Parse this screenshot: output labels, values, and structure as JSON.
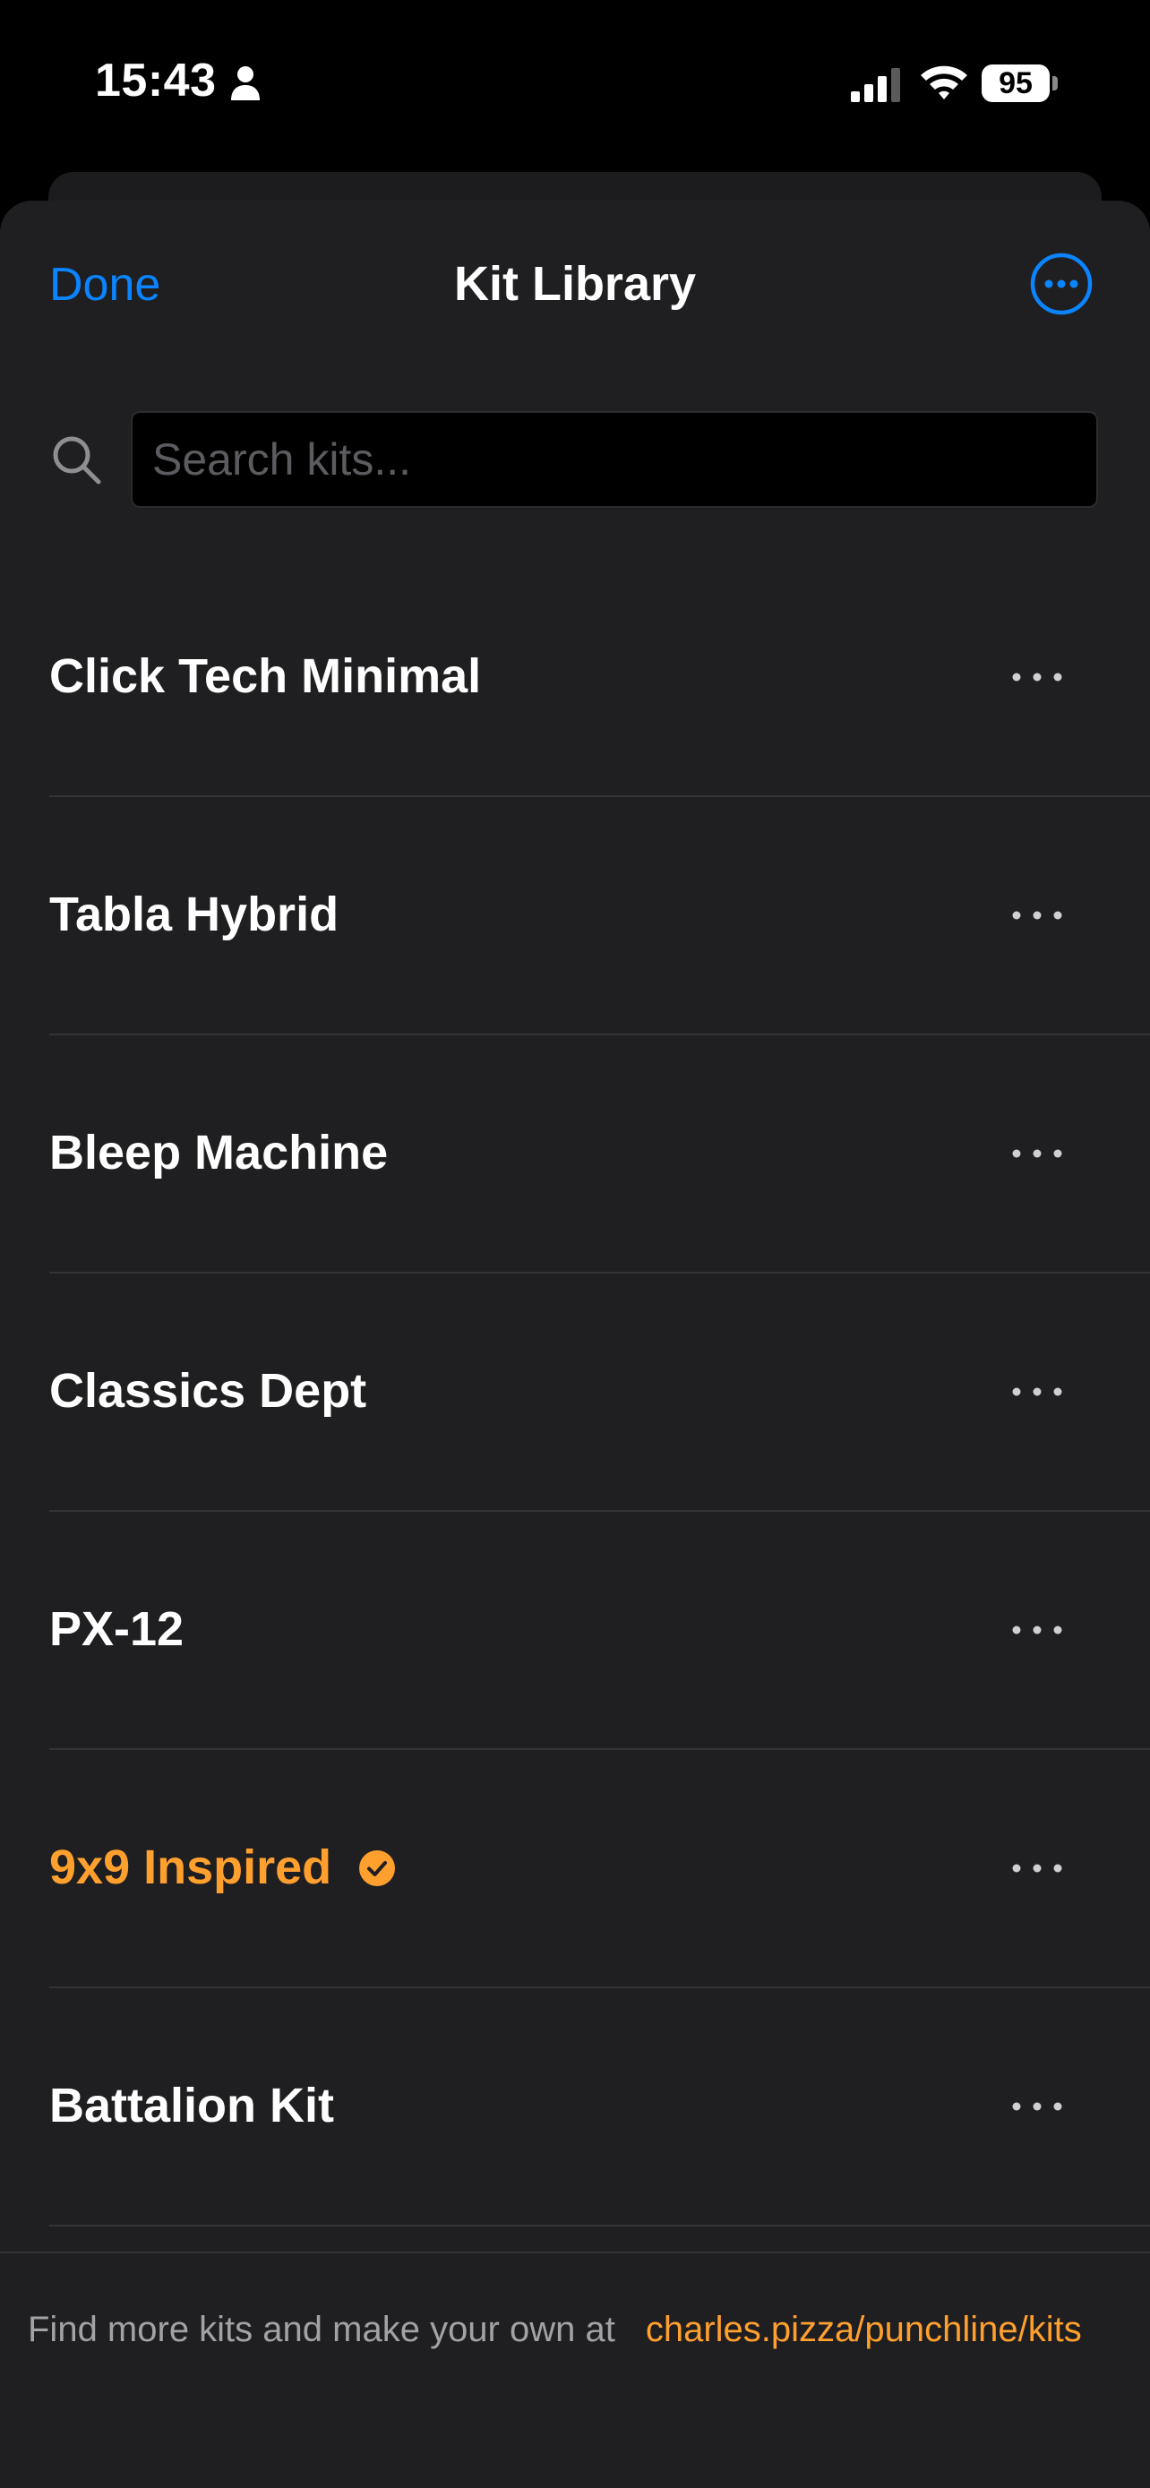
{
  "status_bar": {
    "time": "15:43",
    "battery": "95"
  },
  "nav": {
    "done_label": "Done",
    "title": "Kit Library",
    "more_icon": "ellipsis-circle-icon"
  },
  "search": {
    "placeholder": "Search kits...",
    "value": ""
  },
  "kits": [
    {
      "label": "Click Tech Minimal",
      "selected": false
    },
    {
      "label": "Tabla Hybrid",
      "selected": false
    },
    {
      "label": "Bleep Machine",
      "selected": false
    },
    {
      "label": "Classics Dept",
      "selected": false
    },
    {
      "label": "PX-12",
      "selected": false
    },
    {
      "label": "9x9 Inspired",
      "selected": true
    },
    {
      "label": "Battalion Kit",
      "selected": false
    }
  ],
  "footer": {
    "text": "Find more kits and make your own at",
    "link": "charles.pizza/punchline/kits"
  },
  "colors": {
    "accent_blue": "#0a84ff",
    "accent_orange": "#ff9f2e",
    "sheet_bg": "#1f1f21"
  }
}
